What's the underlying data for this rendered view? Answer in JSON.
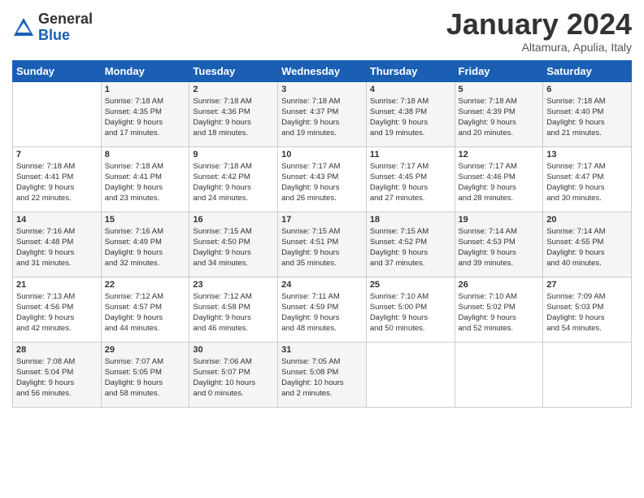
{
  "logo": {
    "general": "General",
    "blue": "Blue"
  },
  "title": "January 2024",
  "subtitle": "Altamura, Apulia, Italy",
  "weekdays": [
    "Sunday",
    "Monday",
    "Tuesday",
    "Wednesday",
    "Thursday",
    "Friday",
    "Saturday"
  ],
  "weeks": [
    [
      {
        "day": "",
        "info": ""
      },
      {
        "day": "1",
        "info": "Sunrise: 7:18 AM\nSunset: 4:35 PM\nDaylight: 9 hours\nand 17 minutes."
      },
      {
        "day": "2",
        "info": "Sunrise: 7:18 AM\nSunset: 4:36 PM\nDaylight: 9 hours\nand 18 minutes."
      },
      {
        "day": "3",
        "info": "Sunrise: 7:18 AM\nSunset: 4:37 PM\nDaylight: 9 hours\nand 19 minutes."
      },
      {
        "day": "4",
        "info": "Sunrise: 7:18 AM\nSunset: 4:38 PM\nDaylight: 9 hours\nand 19 minutes."
      },
      {
        "day": "5",
        "info": "Sunrise: 7:18 AM\nSunset: 4:39 PM\nDaylight: 9 hours\nand 20 minutes."
      },
      {
        "day": "6",
        "info": "Sunrise: 7:18 AM\nSunset: 4:40 PM\nDaylight: 9 hours\nand 21 minutes."
      }
    ],
    [
      {
        "day": "7",
        "info": "Sunrise: 7:18 AM\nSunset: 4:41 PM\nDaylight: 9 hours\nand 22 minutes."
      },
      {
        "day": "8",
        "info": "Sunrise: 7:18 AM\nSunset: 4:41 PM\nDaylight: 9 hours\nand 23 minutes."
      },
      {
        "day": "9",
        "info": "Sunrise: 7:18 AM\nSunset: 4:42 PM\nDaylight: 9 hours\nand 24 minutes."
      },
      {
        "day": "10",
        "info": "Sunrise: 7:17 AM\nSunset: 4:43 PM\nDaylight: 9 hours\nand 26 minutes."
      },
      {
        "day": "11",
        "info": "Sunrise: 7:17 AM\nSunset: 4:45 PM\nDaylight: 9 hours\nand 27 minutes."
      },
      {
        "day": "12",
        "info": "Sunrise: 7:17 AM\nSunset: 4:46 PM\nDaylight: 9 hours\nand 28 minutes."
      },
      {
        "day": "13",
        "info": "Sunrise: 7:17 AM\nSunset: 4:47 PM\nDaylight: 9 hours\nand 30 minutes."
      }
    ],
    [
      {
        "day": "14",
        "info": "Sunrise: 7:16 AM\nSunset: 4:48 PM\nDaylight: 9 hours\nand 31 minutes."
      },
      {
        "day": "15",
        "info": "Sunrise: 7:16 AM\nSunset: 4:49 PM\nDaylight: 9 hours\nand 32 minutes."
      },
      {
        "day": "16",
        "info": "Sunrise: 7:15 AM\nSunset: 4:50 PM\nDaylight: 9 hours\nand 34 minutes."
      },
      {
        "day": "17",
        "info": "Sunrise: 7:15 AM\nSunset: 4:51 PM\nDaylight: 9 hours\nand 35 minutes."
      },
      {
        "day": "18",
        "info": "Sunrise: 7:15 AM\nSunset: 4:52 PM\nDaylight: 9 hours\nand 37 minutes."
      },
      {
        "day": "19",
        "info": "Sunrise: 7:14 AM\nSunset: 4:53 PM\nDaylight: 9 hours\nand 39 minutes."
      },
      {
        "day": "20",
        "info": "Sunrise: 7:14 AM\nSunset: 4:55 PM\nDaylight: 9 hours\nand 40 minutes."
      }
    ],
    [
      {
        "day": "21",
        "info": "Sunrise: 7:13 AM\nSunset: 4:56 PM\nDaylight: 9 hours\nand 42 minutes."
      },
      {
        "day": "22",
        "info": "Sunrise: 7:12 AM\nSunset: 4:57 PM\nDaylight: 9 hours\nand 44 minutes."
      },
      {
        "day": "23",
        "info": "Sunrise: 7:12 AM\nSunset: 4:58 PM\nDaylight: 9 hours\nand 46 minutes."
      },
      {
        "day": "24",
        "info": "Sunrise: 7:11 AM\nSunset: 4:59 PM\nDaylight: 9 hours\nand 48 minutes."
      },
      {
        "day": "25",
        "info": "Sunrise: 7:10 AM\nSunset: 5:00 PM\nDaylight: 9 hours\nand 50 minutes."
      },
      {
        "day": "26",
        "info": "Sunrise: 7:10 AM\nSunset: 5:02 PM\nDaylight: 9 hours\nand 52 minutes."
      },
      {
        "day": "27",
        "info": "Sunrise: 7:09 AM\nSunset: 5:03 PM\nDaylight: 9 hours\nand 54 minutes."
      }
    ],
    [
      {
        "day": "28",
        "info": "Sunrise: 7:08 AM\nSunset: 5:04 PM\nDaylight: 9 hours\nand 56 minutes."
      },
      {
        "day": "29",
        "info": "Sunrise: 7:07 AM\nSunset: 5:05 PM\nDaylight: 9 hours\nand 58 minutes."
      },
      {
        "day": "30",
        "info": "Sunrise: 7:06 AM\nSunset: 5:07 PM\nDaylight: 10 hours\nand 0 minutes."
      },
      {
        "day": "31",
        "info": "Sunrise: 7:05 AM\nSunset: 5:08 PM\nDaylight: 10 hours\nand 2 minutes."
      },
      {
        "day": "",
        "info": ""
      },
      {
        "day": "",
        "info": ""
      },
      {
        "day": "",
        "info": ""
      }
    ]
  ]
}
